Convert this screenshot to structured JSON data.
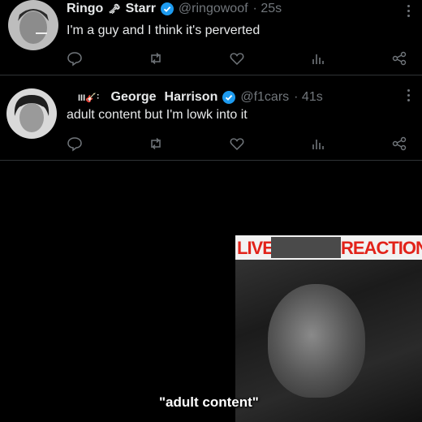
{
  "tweets": [
    {
      "name_first": "Ringo",
      "name_emoji": "🗝",
      "name_last": "Starr",
      "handle": "@ringowoof",
      "time": "· 25s",
      "text": "I'm a guy and I think it's perverted"
    },
    {
      "name_emoji": "III🎸˸",
      "name_first": "George",
      "name_last": "Harrison",
      "handle": "@f1cars",
      "time": "· 41s",
      "text": "adult content but I'm lowk into it"
    }
  ],
  "media": {
    "live_left": "LIVE",
    "live_right": "REACTION",
    "caption": "\"adult content\""
  },
  "colors": {
    "verified": "#1d9bf0",
    "live_red": "#e2231a",
    "muted": "#71767b"
  },
  "icons": [
    "reply-icon",
    "retweet-icon",
    "like-icon",
    "views-icon",
    "share-icon",
    "more-icon",
    "verified-icon"
  ]
}
